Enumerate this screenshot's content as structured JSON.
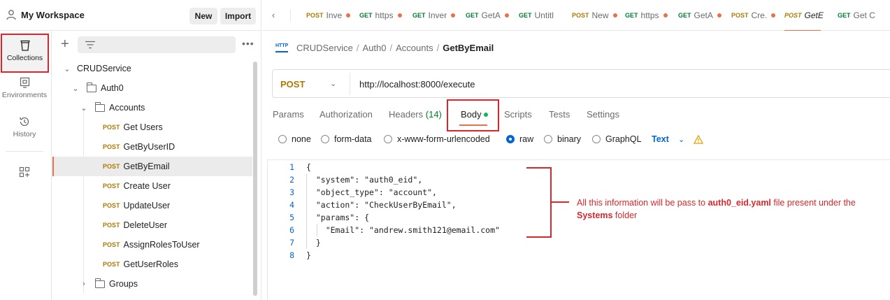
{
  "workspace": {
    "name": "My Workspace",
    "new_label": "New",
    "import_label": "Import"
  },
  "rail": {
    "collections": "Collections",
    "environments": "Environments",
    "history": "History"
  },
  "sidebar": {
    "more_label": "•••",
    "tree": [
      {
        "label": "CRUDService"
      },
      {
        "label": "Auth0"
      },
      {
        "label": "Accounts"
      },
      {
        "method": "POST",
        "label": "Get Users"
      },
      {
        "method": "POST",
        "label": "GetByUserID"
      },
      {
        "method": "POST",
        "label": "GetByEmail"
      },
      {
        "method": "POST",
        "label": "Create User"
      },
      {
        "method": "POST",
        "label": "UpdateUser"
      },
      {
        "method": "POST",
        "label": "DeleteUser"
      },
      {
        "method": "POST",
        "label": "AssignRolesToUser"
      },
      {
        "method": "POST",
        "label": "GetUserRoles"
      },
      {
        "label": "Groups"
      }
    ]
  },
  "tabs": [
    {
      "method": "POST",
      "label": "Inve"
    },
    {
      "method": "GET",
      "label": "https"
    },
    {
      "method": "GET",
      "label": "Inver"
    },
    {
      "method": "GET",
      "label": "GetA"
    },
    {
      "method": "GET",
      "label": "Untitl"
    },
    {
      "method": "POST",
      "label": "New"
    },
    {
      "method": "GET",
      "label": "https"
    },
    {
      "method": "GET",
      "label": "GetA"
    },
    {
      "method": "POST",
      "label": "Cre."
    },
    {
      "method": "POST",
      "label": "GetE"
    },
    {
      "method": "GET",
      "label": "Get C"
    }
  ],
  "breadcrumb": {
    "http_icon": "HTTP",
    "items": [
      "CRUDService",
      "Auth0",
      "Accounts",
      "GetByEmail"
    ]
  },
  "request": {
    "method": "POST",
    "url": "http://localhost:8000/execute"
  },
  "request_tabs": {
    "params": "Params",
    "authorization": "Authorization",
    "headers": "Headers",
    "headers_count": "(14)",
    "body": "Body",
    "scripts": "Scripts",
    "tests": "Tests",
    "settings": "Settings"
  },
  "body_types": {
    "none": "none",
    "form_data": "form-data",
    "urlencoded": "x-www-form-urlencoded",
    "raw": "raw",
    "binary": "binary",
    "graphql": "GraphQL",
    "selected": "raw",
    "format": "Text"
  },
  "code": [
    {
      "n": "1",
      "text": "{"
    },
    {
      "n": "2",
      "text": "  \"system\": \"auth0_eid\","
    },
    {
      "n": "3",
      "text": "  \"object_type\": \"account\","
    },
    {
      "n": "4",
      "text": "  \"action\": \"CheckUserByEmail\","
    },
    {
      "n": "5",
      "text": "  \"params\": {"
    },
    {
      "n": "6",
      "text": "    \"Email\": \"andrew.smith121@email.com\""
    },
    {
      "n": "7",
      "text": "  }"
    },
    {
      "n": "8",
      "text": "}"
    }
  ],
  "annotation": {
    "part1": "All this information will be pass to ",
    "file": "auth0_eid.yaml",
    "part2": " file present under the ",
    "folder": "Systems",
    "part3": " folder"
  },
  "colors": {
    "accent_red": "#d9262c",
    "post": "#ad7a03",
    "get": "#007f31",
    "link_blue": "#0265d2",
    "tab_dot": "#e8704a"
  }
}
